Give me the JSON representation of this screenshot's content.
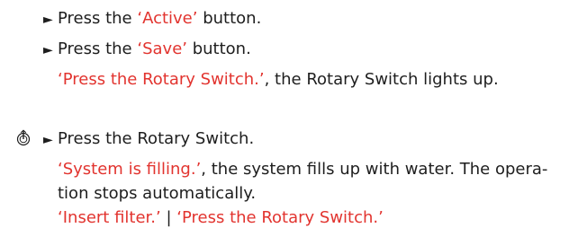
{
  "instructions": [
    {
      "marker": "►",
      "prefix": "Press the ",
      "quote": "‘Active’",
      "suffix": " button."
    },
    {
      "marker": "►",
      "prefix": "Press the ",
      "quote": "‘Save’",
      "suffix": " button."
    },
    {
      "quote": "‘Press the Rotary Switch.’",
      "suffix": ", the Rotary Switch lights up."
    },
    {
      "icon": "rotary-switch-icon",
      "marker": "►",
      "text": "Press the Rotary Switch."
    },
    {
      "quote": "‘System is filling.’",
      "suffix": ", the system fills up with water. The opera-"
    },
    {
      "text": "tion stops automatically."
    },
    {
      "quote1": "‘Insert filter.’",
      "separator": " | ",
      "quote2": "‘Press the Rotary Switch.’"
    }
  ],
  "colors": {
    "text": "#1e1e1e",
    "accent": "#e2342f"
  }
}
